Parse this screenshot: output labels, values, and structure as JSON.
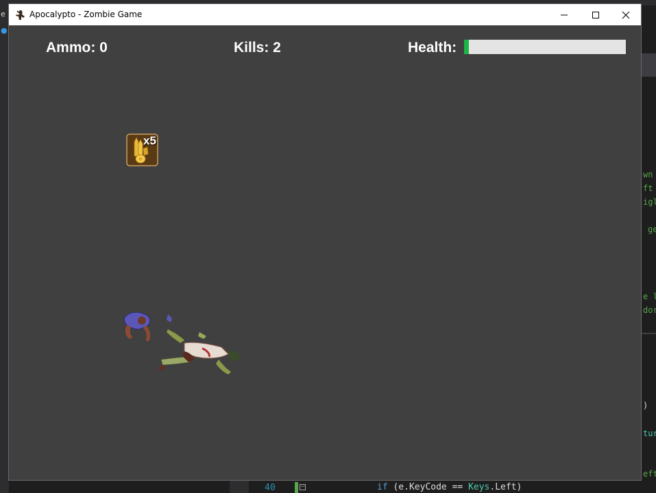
{
  "background_ide": {
    "right_edge_fragments": [
      "wn",
      "ft",
      "igl",
      "ge",
      "e l",
      "dor",
      ")",
      "tur",
      "eft"
    ],
    "bottom": {
      "line_number": "40",
      "code_if": "if",
      "code_open": " (e.KeyCode == ",
      "code_type": "Keys",
      "code_close": ".Left)"
    }
  },
  "window": {
    "title": "Apocalypto - Zombie Game",
    "controls": {
      "minimize": "minimize-icon",
      "maximize": "maximize-icon",
      "close": "close-icon"
    }
  },
  "hud": {
    "ammo_label": "Ammo: 0",
    "kills_label": "Kills: 2",
    "health_label": "Health:",
    "health_fraction": 0.03,
    "health_color": "#1db546"
  },
  "ammo_pickup": {
    "count_label": "x5",
    "icon": "bullets-icon"
  },
  "colors": {
    "game_background": "#404040",
    "pickup_border": "#c8a060"
  }
}
